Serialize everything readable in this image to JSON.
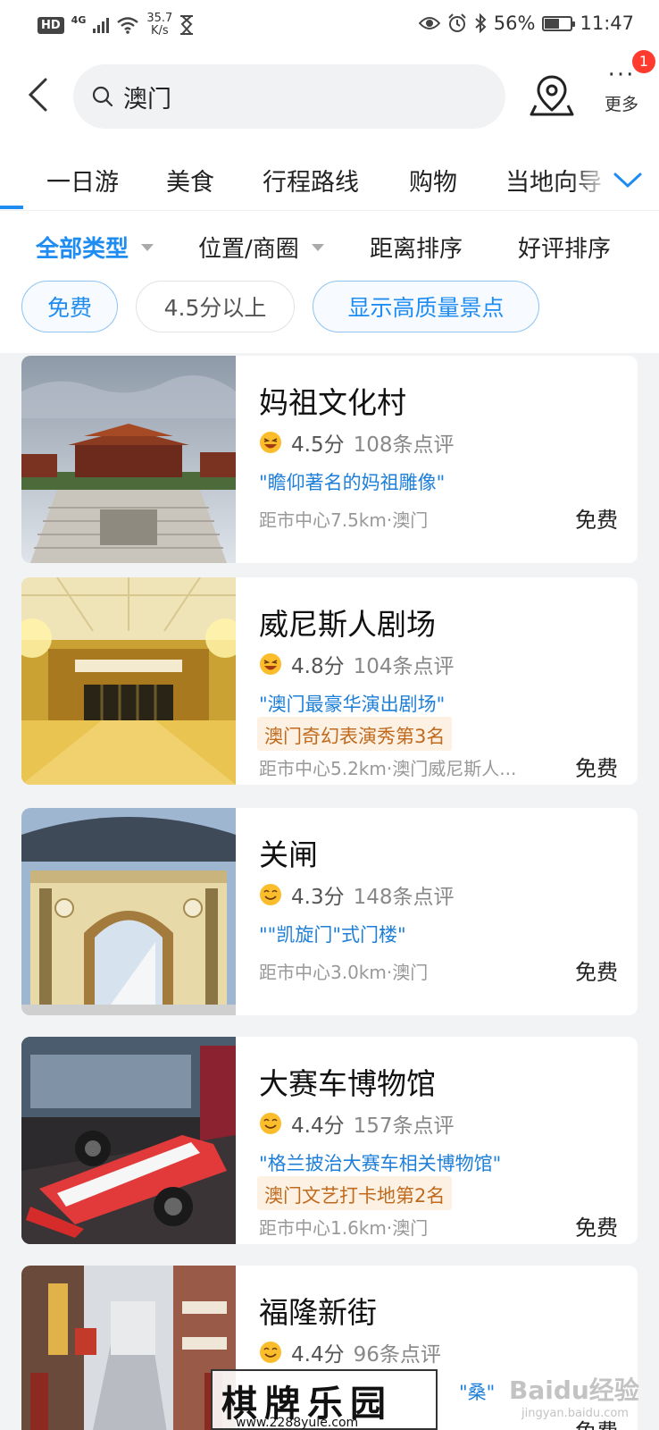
{
  "status_bar": {
    "hd": "HD",
    "network": "4G",
    "speed_value": "35.7",
    "speed_unit": "K/s",
    "battery": "56%",
    "battery_level": 0.56,
    "time": "11:47"
  },
  "header": {
    "search_query": "澳门",
    "more_label": "更多",
    "more_dots": "···",
    "notification_count": "1"
  },
  "category_tabs": [
    "一日游",
    "美食",
    "行程路线",
    "购物",
    "当地向导"
  ],
  "filters": {
    "type": "全部类型",
    "location": "位置/商圈",
    "distance_sort": "距离排序",
    "rating_sort": "好评排序"
  },
  "chips": {
    "free": "免费",
    "rating": "4.5分以上",
    "quality": "显示高质量景点"
  },
  "colors": {
    "accent": "#1e8cf0",
    "rank_bg": "#fdf1e4",
    "rank_text": "#c06a1d"
  },
  "listings": [
    {
      "name": "妈祖文化村",
      "emoji": "laughing-face-icon",
      "score": "4.5分",
      "reviews": "108条点评",
      "quote": "\"瞻仰著名的妈祖雕像\"",
      "rank": "",
      "distance": "距市中心7.5km·澳门",
      "price": "免费"
    },
    {
      "name": "威尼斯人剧场",
      "emoji": "laughing-face-icon",
      "score": "4.8分",
      "reviews": "104条点评",
      "quote": "\"澳门最豪华演出剧场\"",
      "rank": "澳门奇幻表演秀第3名",
      "distance": "距市中心5.2km·澳门威尼斯人...",
      "price": "免费"
    },
    {
      "name": "关闸",
      "emoji": "smiling-face-icon",
      "score": "4.3分",
      "reviews": "148条点评",
      "quote": "\"\"凯旋门\"式门楼\"",
      "rank": "",
      "distance": "距市中心3.0km·澳门",
      "price": "免费"
    },
    {
      "name": "大赛车博物馆",
      "emoji": "smiling-face-icon",
      "score": "4.4分",
      "reviews": "157条点评",
      "quote": "\"格兰披治大赛车相关博物馆\"",
      "rank": "澳门文艺打卡地第2名",
      "distance": "距市中心1.6km·澳门",
      "price": "免费"
    },
    {
      "name": "福隆新街",
      "emoji": "smiling-face-icon",
      "score": "4.4分",
      "reviews": "96条点评",
      "quote": "\"桑\"",
      "rank": "",
      "distance": "",
      "price": "免费"
    }
  ],
  "watermark": {
    "stamp": "棋牌乐园",
    "stamp_url": "www.2288yule.com",
    "baidu": "Baidu经验",
    "baidu_url": "jingyan.baidu.com"
  }
}
